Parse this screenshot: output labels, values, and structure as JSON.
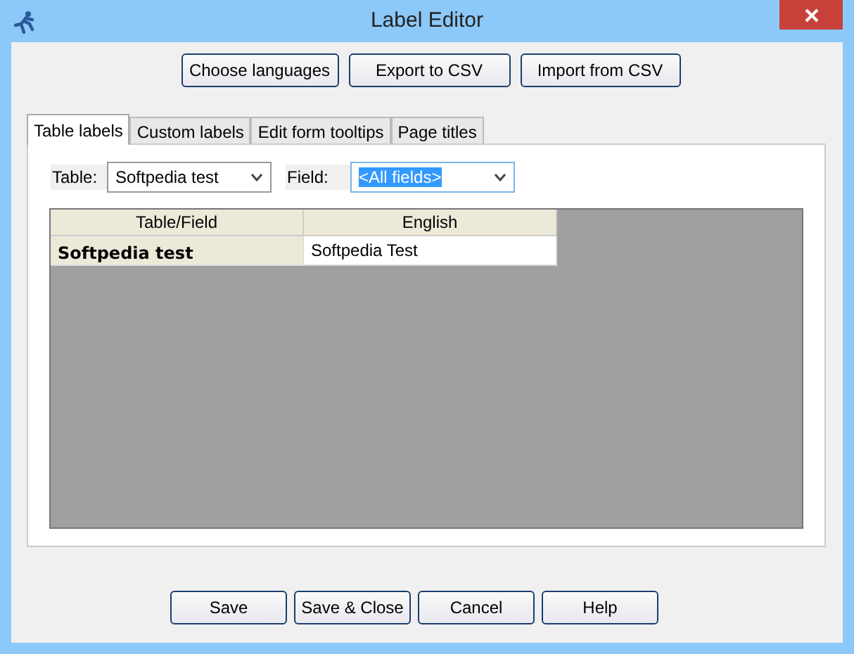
{
  "window": {
    "title": "Label Editor"
  },
  "top_buttons": [
    "Choose languages",
    "Export to CSV",
    "Import from CSV"
  ],
  "tabs": [
    {
      "label": "Table labels",
      "selected": true
    },
    {
      "label": "Custom labels",
      "selected": false
    },
    {
      "label": "Edit form tooltips",
      "selected": false
    },
    {
      "label": "Page titles",
      "selected": false
    }
  ],
  "filters": [
    {
      "label": "Table:",
      "value": "Softpedia test",
      "focused": false
    },
    {
      "label": "Field:",
      "value": "<All fields>",
      "focused": true
    }
  ],
  "table": {
    "columns": [
      "Table/Field",
      "English"
    ],
    "rows": [
      [
        "Softpedia test",
        "Softpedia Test"
      ]
    ]
  },
  "bottom_buttons": [
    "Save",
    "Save & Close",
    "Cancel",
    "Help"
  ]
}
